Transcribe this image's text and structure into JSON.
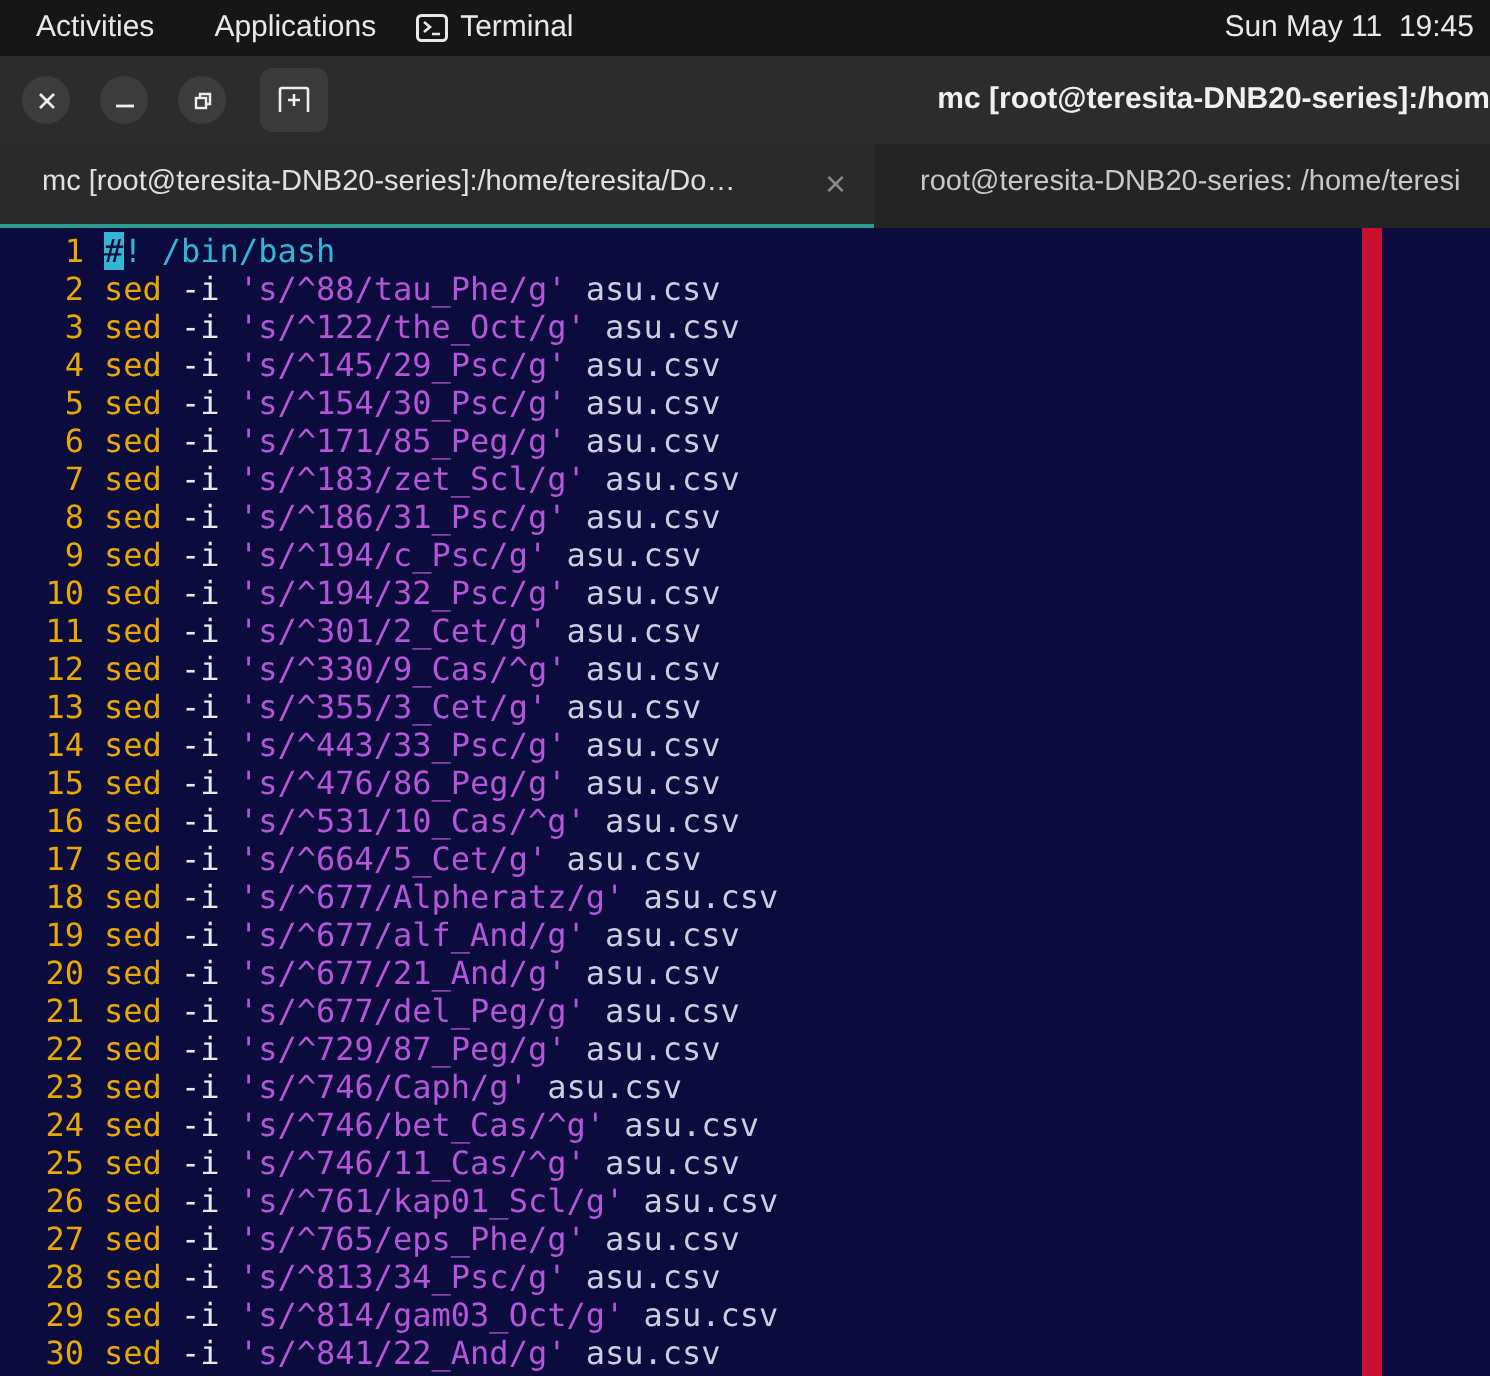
{
  "top_bar": {
    "activities": "Activities",
    "applications": "Applications",
    "app_name": "Terminal",
    "clock": "Sun May 11  19:45"
  },
  "window": {
    "title": "mc [root@teresita-DNB20-series]:/hom"
  },
  "tabs": [
    {
      "label": "mc [root@teresita-DNB20-series]:/home/teresita/Do…",
      "selected": true,
      "close": "×"
    },
    {
      "label": "root@teresita-DNB20-series: /home/teresi",
      "selected": false
    }
  ],
  "editor": {
    "lines": [
      {
        "number": "1",
        "tokens": [
          {
            "kind": "cursor",
            "text": "#"
          },
          {
            "kind": "comment",
            "text": "! /bin/bash"
          }
        ]
      },
      {
        "number": "2",
        "tokens": [
          {
            "kind": "keyword",
            "text": "sed"
          },
          {
            "kind": "flag",
            "text": "-i"
          },
          {
            "kind": "string",
            "text": "'s/^88/tau_Phe/g'"
          },
          {
            "kind": "plain",
            "text": "asu.csv"
          }
        ]
      },
      {
        "number": "3",
        "tokens": [
          {
            "kind": "keyword",
            "text": "sed"
          },
          {
            "kind": "flag",
            "text": "-i"
          },
          {
            "kind": "string",
            "text": "'s/^122/the_Oct/g'"
          },
          {
            "kind": "plain",
            "text": "asu.csv"
          }
        ]
      },
      {
        "number": "4",
        "tokens": [
          {
            "kind": "keyword",
            "text": "sed"
          },
          {
            "kind": "flag",
            "text": "-i"
          },
          {
            "kind": "string",
            "text": "'s/^145/29_Psc/g'"
          },
          {
            "kind": "plain",
            "text": "asu.csv"
          }
        ]
      },
      {
        "number": "5",
        "tokens": [
          {
            "kind": "keyword",
            "text": "sed"
          },
          {
            "kind": "flag",
            "text": "-i"
          },
          {
            "kind": "string",
            "text": "'s/^154/30_Psc/g'"
          },
          {
            "kind": "plain",
            "text": "asu.csv"
          }
        ]
      },
      {
        "number": "6",
        "tokens": [
          {
            "kind": "keyword",
            "text": "sed"
          },
          {
            "kind": "flag",
            "text": "-i"
          },
          {
            "kind": "string",
            "text": "'s/^171/85_Peg/g'"
          },
          {
            "kind": "plain",
            "text": "asu.csv"
          }
        ]
      },
      {
        "number": "7",
        "tokens": [
          {
            "kind": "keyword",
            "text": "sed"
          },
          {
            "kind": "flag",
            "text": "-i"
          },
          {
            "kind": "string",
            "text": "'s/^183/zet_Scl/g'"
          },
          {
            "kind": "plain",
            "text": "asu.csv"
          }
        ]
      },
      {
        "number": "8",
        "tokens": [
          {
            "kind": "keyword",
            "text": "sed"
          },
          {
            "kind": "flag",
            "text": "-i"
          },
          {
            "kind": "string",
            "text": "'s/^186/31_Psc/g'"
          },
          {
            "kind": "plain",
            "text": "asu.csv"
          }
        ]
      },
      {
        "number": "9",
        "tokens": [
          {
            "kind": "keyword",
            "text": "sed"
          },
          {
            "kind": "flag",
            "text": "-i"
          },
          {
            "kind": "string",
            "text": "'s/^194/c_Psc/g'"
          },
          {
            "kind": "plain",
            "text": "asu.csv"
          }
        ]
      },
      {
        "number": "10",
        "tokens": [
          {
            "kind": "keyword",
            "text": "sed"
          },
          {
            "kind": "flag",
            "text": "-i"
          },
          {
            "kind": "string",
            "text": "'s/^194/32_Psc/g'"
          },
          {
            "kind": "plain",
            "text": "asu.csv"
          }
        ]
      },
      {
        "number": "11",
        "tokens": [
          {
            "kind": "keyword",
            "text": "sed"
          },
          {
            "kind": "flag",
            "text": "-i"
          },
          {
            "kind": "string",
            "text": "'s/^301/2_Cet/g'"
          },
          {
            "kind": "plain",
            "text": "asu.csv"
          }
        ]
      },
      {
        "number": "12",
        "tokens": [
          {
            "kind": "keyword",
            "text": "sed"
          },
          {
            "kind": "flag",
            "text": "-i"
          },
          {
            "kind": "string",
            "text": "'s/^330/9_Cas/^g'"
          },
          {
            "kind": "plain",
            "text": "asu.csv"
          }
        ]
      },
      {
        "number": "13",
        "tokens": [
          {
            "kind": "keyword",
            "text": "sed"
          },
          {
            "kind": "flag",
            "text": "-i"
          },
          {
            "kind": "string",
            "text": "'s/^355/3_Cet/g'"
          },
          {
            "kind": "plain",
            "text": "asu.csv"
          }
        ]
      },
      {
        "number": "14",
        "tokens": [
          {
            "kind": "keyword",
            "text": "sed"
          },
          {
            "kind": "flag",
            "text": "-i"
          },
          {
            "kind": "string",
            "text": "'s/^443/33_Psc/g'"
          },
          {
            "kind": "plain",
            "text": "asu.csv"
          }
        ]
      },
      {
        "number": "15",
        "tokens": [
          {
            "kind": "keyword",
            "text": "sed"
          },
          {
            "kind": "flag",
            "text": "-i"
          },
          {
            "kind": "string",
            "text": "'s/^476/86_Peg/g'"
          },
          {
            "kind": "plain",
            "text": "asu.csv"
          }
        ]
      },
      {
        "number": "16",
        "tokens": [
          {
            "kind": "keyword",
            "text": "sed"
          },
          {
            "kind": "flag",
            "text": "-i"
          },
          {
            "kind": "string",
            "text": "'s/^531/10_Cas/^g'"
          },
          {
            "kind": "plain",
            "text": "asu.csv"
          }
        ]
      },
      {
        "number": "17",
        "tokens": [
          {
            "kind": "keyword",
            "text": "sed"
          },
          {
            "kind": "flag",
            "text": "-i"
          },
          {
            "kind": "string",
            "text": "'s/^664/5_Cet/g'"
          },
          {
            "kind": "plain",
            "text": "asu.csv"
          }
        ]
      },
      {
        "number": "18",
        "tokens": [
          {
            "kind": "keyword",
            "text": "sed"
          },
          {
            "kind": "flag",
            "text": "-i"
          },
          {
            "kind": "string",
            "text": "'s/^677/Alpheratz/g'"
          },
          {
            "kind": "plain",
            "text": "asu.csv"
          }
        ]
      },
      {
        "number": "19",
        "tokens": [
          {
            "kind": "keyword",
            "text": "sed"
          },
          {
            "kind": "flag",
            "text": "-i"
          },
          {
            "kind": "string",
            "text": "'s/^677/alf_And/g'"
          },
          {
            "kind": "plain",
            "text": "asu.csv"
          }
        ]
      },
      {
        "number": "20",
        "tokens": [
          {
            "kind": "keyword",
            "text": "sed"
          },
          {
            "kind": "flag",
            "text": "-i"
          },
          {
            "kind": "string",
            "text": "'s/^677/21_And/g'"
          },
          {
            "kind": "plain",
            "text": "asu.csv"
          }
        ]
      },
      {
        "number": "21",
        "tokens": [
          {
            "kind": "keyword",
            "text": "sed"
          },
          {
            "kind": "flag",
            "text": "-i"
          },
          {
            "kind": "string",
            "text": "'s/^677/del_Peg/g'"
          },
          {
            "kind": "plain",
            "text": "asu.csv"
          }
        ]
      },
      {
        "number": "22",
        "tokens": [
          {
            "kind": "keyword",
            "text": "sed"
          },
          {
            "kind": "flag",
            "text": "-i"
          },
          {
            "kind": "string",
            "text": "'s/^729/87_Peg/g'"
          },
          {
            "kind": "plain",
            "text": "asu.csv"
          }
        ]
      },
      {
        "number": "23",
        "tokens": [
          {
            "kind": "keyword",
            "text": "sed"
          },
          {
            "kind": "flag",
            "text": "-i"
          },
          {
            "kind": "string",
            "text": "'s/^746/Caph/g'"
          },
          {
            "kind": "plain",
            "text": "asu.csv"
          }
        ]
      },
      {
        "number": "24",
        "tokens": [
          {
            "kind": "keyword",
            "text": "sed"
          },
          {
            "kind": "flag",
            "text": "-i"
          },
          {
            "kind": "string",
            "text": "'s/^746/bet_Cas/^g'"
          },
          {
            "kind": "plain",
            "text": "asu.csv"
          }
        ]
      },
      {
        "number": "25",
        "tokens": [
          {
            "kind": "keyword",
            "text": "sed"
          },
          {
            "kind": "flag",
            "text": "-i"
          },
          {
            "kind": "string",
            "text": "'s/^746/11_Cas/^g'"
          },
          {
            "kind": "plain",
            "text": "asu.csv"
          }
        ]
      },
      {
        "number": "26",
        "tokens": [
          {
            "kind": "keyword",
            "text": "sed"
          },
          {
            "kind": "flag",
            "text": "-i"
          },
          {
            "kind": "string",
            "text": "'s/^761/kap01_Scl/g'"
          },
          {
            "kind": "plain",
            "text": "asu.csv"
          }
        ]
      },
      {
        "number": "27",
        "tokens": [
          {
            "kind": "keyword",
            "text": "sed"
          },
          {
            "kind": "flag",
            "text": "-i"
          },
          {
            "kind": "string",
            "text": "'s/^765/eps_Phe/g'"
          },
          {
            "kind": "plain",
            "text": "asu.csv"
          }
        ]
      },
      {
        "number": "28",
        "tokens": [
          {
            "kind": "keyword",
            "text": "sed"
          },
          {
            "kind": "flag",
            "text": "-i"
          },
          {
            "kind": "string",
            "text": "'s/^813/34_Psc/g'"
          },
          {
            "kind": "plain",
            "text": "asu.csv"
          }
        ]
      },
      {
        "number": "29",
        "tokens": [
          {
            "kind": "keyword",
            "text": "sed"
          },
          {
            "kind": "flag",
            "text": "-i"
          },
          {
            "kind": "string",
            "text": "'s/^814/gam03_Oct/g'"
          },
          {
            "kind": "plain",
            "text": "asu.csv"
          }
        ]
      },
      {
        "number": "30",
        "tokens": [
          {
            "kind": "keyword",
            "text": "sed"
          },
          {
            "kind": "flag",
            "text": "-i"
          },
          {
            "kind": "string",
            "text": "'s/^841/22_And/g'"
          },
          {
            "kind": "plain",
            "text": "asu.csv"
          }
        ]
      }
    ]
  }
}
